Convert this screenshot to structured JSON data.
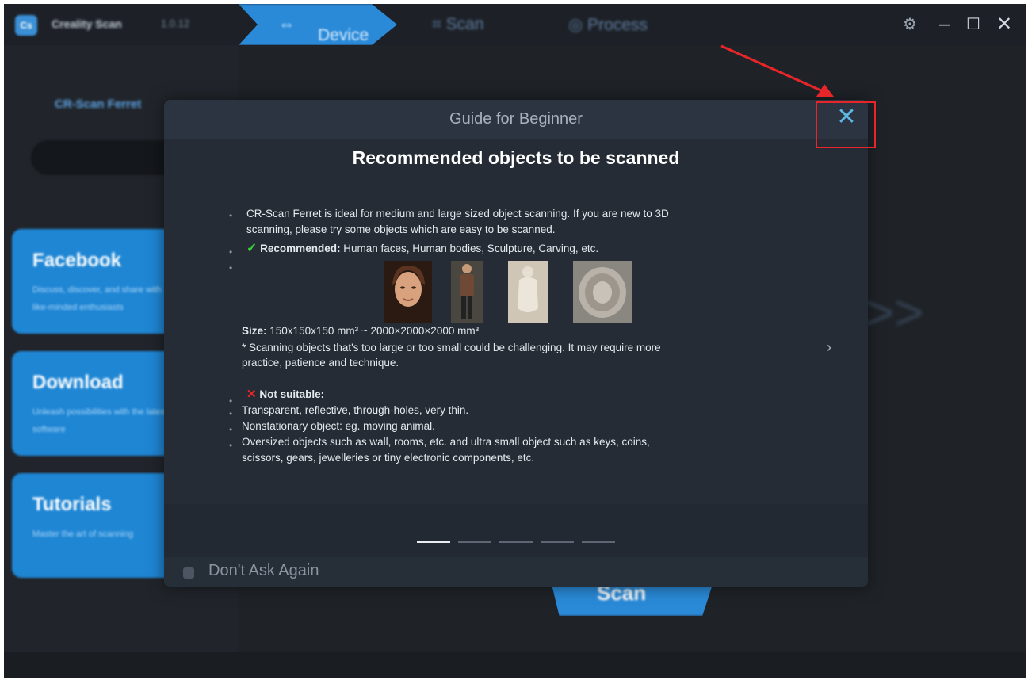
{
  "app": {
    "name": "Creality Scan",
    "version": "1.0.12",
    "nav": {
      "device": "Device",
      "scan": "Scan",
      "process": "Process"
    },
    "window_controls": {
      "settings_icon": "gear-icon",
      "minimize": "–",
      "maximize": "☐",
      "close": "✕"
    }
  },
  "sidebar": {
    "device_name": "CR-Scan Ferret",
    "cards": [
      {
        "title": "Facebook",
        "desc": "Discuss, discover, and share with like-minded enthusiasts"
      },
      {
        "title": "Download",
        "desc": "Unleash possibilities with the latest software"
      },
      {
        "title": "Tutorials",
        "desc": "Master the art of scanning"
      }
    ]
  },
  "main": {
    "scan_button": "Scan"
  },
  "modal": {
    "header_title": "Guide for Beginner",
    "close_label": "✕",
    "content_title": "Recommended objects to be scanned",
    "intro_line1": "CR-Scan Ferret is ideal for medium and large sized object scanning. If you are new to 3D",
    "intro_line2": "scanning, please try some objects which are easy to be scanned.",
    "check_mark": "✓",
    "recommended_label": "Recommended:",
    "recommended_items": "Human faces, Human bodies, Sculpture, Carving, etc.",
    "images": [
      "Human face",
      "Human body",
      "Sculpture",
      "Carving"
    ],
    "size_label": "Size:",
    "size_value": "150x150x150  mm³  ~ 2000×2000×2000  mm³",
    "note_line1": "* Scanning objects that's too large or too small could be challenging. It may require more",
    "note_line2": "practice, patience and technique.",
    "cross_mark": "✕",
    "not_suitable_label": "Not suitable:",
    "not_suitable_1": "Transparent, reflective, through-holes, very thin.",
    "not_suitable_2": "Nonstationary object: eg. moving animal.",
    "not_suitable_3a": "Oversized objects such as wall, rooms, etc. and ultra small object such as keys, coins,",
    "not_suitable_3b": "scissors, gears, jewelleries or tiny electronic components, etc.",
    "next_arrow": "›",
    "page_count": 5,
    "current_page": 1,
    "dont_ask_again": "Don't Ask Again"
  }
}
